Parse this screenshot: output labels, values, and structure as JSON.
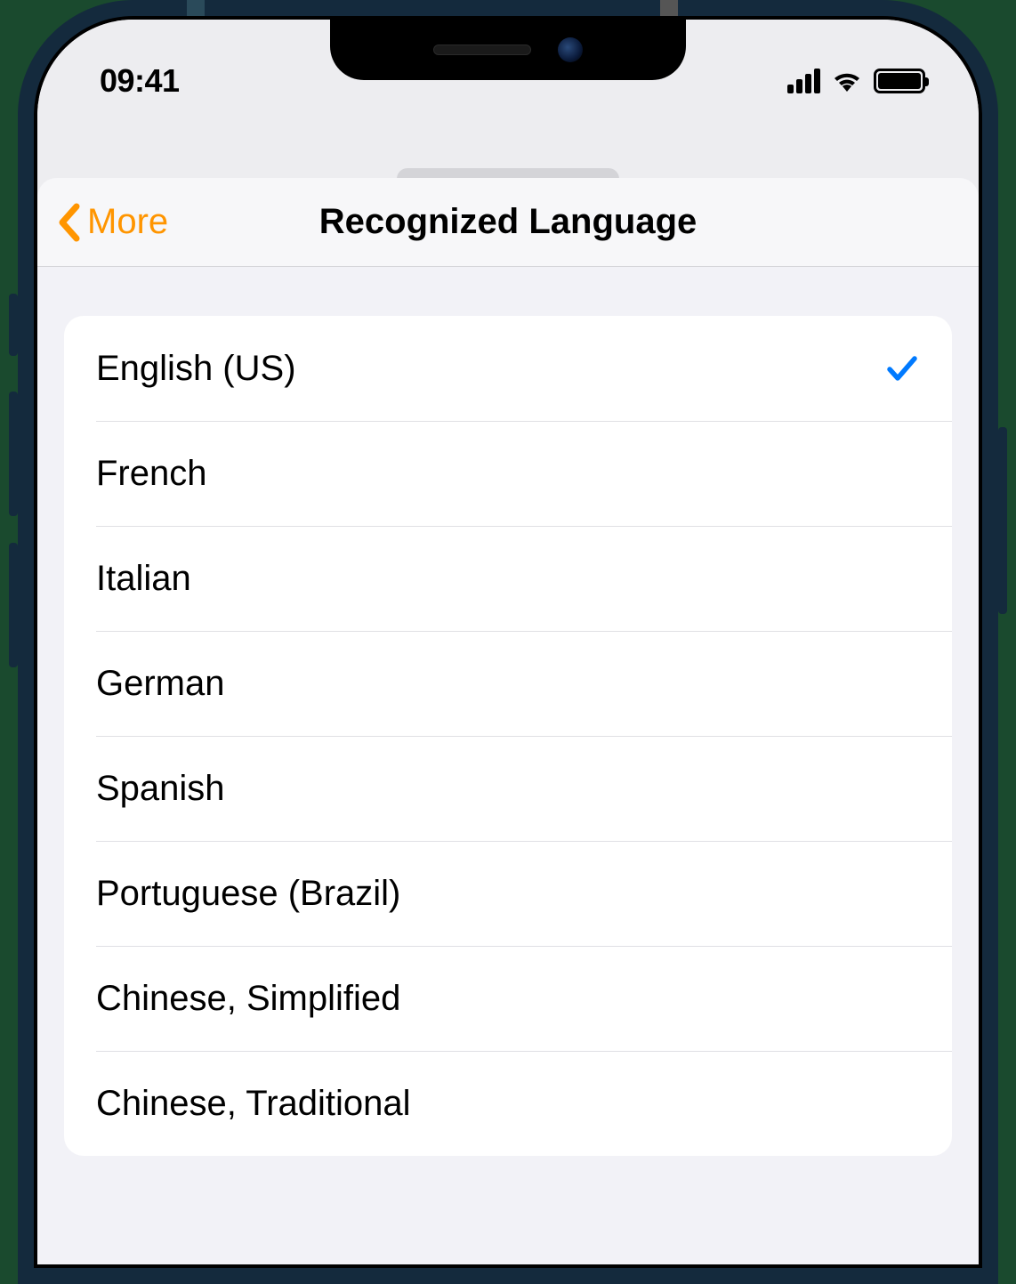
{
  "status": {
    "time": "09:41"
  },
  "nav": {
    "back_label": "More",
    "title": "Recognized Language"
  },
  "languages": {
    "items": [
      {
        "label": "English (US)",
        "selected": true
      },
      {
        "label": "French",
        "selected": false
      },
      {
        "label": "Italian",
        "selected": false
      },
      {
        "label": "German",
        "selected": false
      },
      {
        "label": "Spanish",
        "selected": false
      },
      {
        "label": "Portuguese (Brazil)",
        "selected": false
      },
      {
        "label": "Chinese, Simplified",
        "selected": false
      },
      {
        "label": "Chinese, Traditional",
        "selected": false
      }
    ]
  },
  "colors": {
    "accent": "#ff9500",
    "check": "#007aff"
  }
}
